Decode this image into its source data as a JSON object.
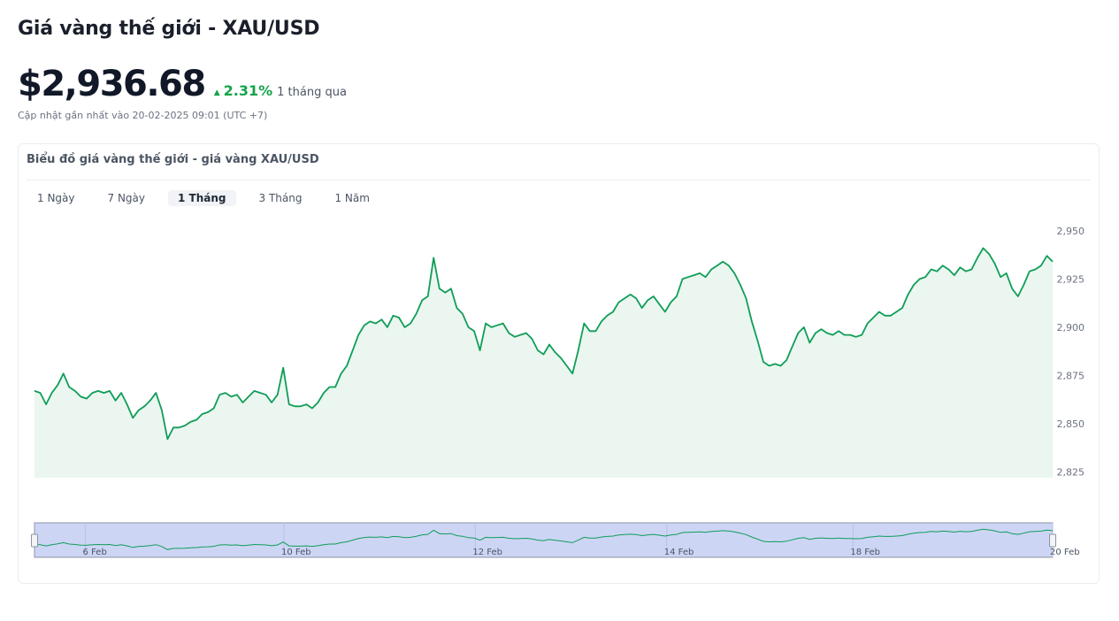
{
  "header": {
    "title": "Giá vàng thế giới - XAU/USD",
    "price": "$2,936.68",
    "change_percent": "2.31%",
    "change_period": "1 tháng qua",
    "updated": "Cập nhật gần nhất vào 20-02-2025 09:01 (UTC +7)"
  },
  "card": {
    "title": "Biểu đồ giá vàng thế giới - giá vàng XAU/USD",
    "tabs": [
      {
        "label": "1 Ngày",
        "active": false
      },
      {
        "label": "7 Ngày",
        "active": false
      },
      {
        "label": "1 Tháng",
        "active": true
      },
      {
        "label": "3 Tháng",
        "active": false
      },
      {
        "label": "1 Năm",
        "active": false
      }
    ]
  },
  "colors": {
    "line": "#0f9d58",
    "area": "#eaf6ef",
    "navigator_fill": "#cdd5f5",
    "navigator_border": "#8d93a6",
    "positive": "#16a34a"
  },
  "chart_data": {
    "type": "area",
    "y_ticks": [
      "2,825",
      "2,850",
      "2,875",
      "2,900",
      "2,925",
      "2,950"
    ],
    "y_tick_values": [
      2825,
      2850,
      2875,
      2900,
      2925,
      2950
    ],
    "ylim": [
      2822,
      2955
    ],
    "navigator_ticks": [
      "6 Feb",
      "10 Feb",
      "12 Feb",
      "14 Feb",
      "18 Feb",
      "20 Feb"
    ],
    "navigator_tick_positions": [
      0.05,
      0.245,
      0.433,
      0.621,
      0.804,
      1.0
    ],
    "grid": false,
    "series": [
      {
        "values": [
          2867,
          2866,
          2860,
          2866,
          2870,
          2876,
          2869,
          2867,
          2864,
          2863,
          2866,
          2867,
          2866,
          2867,
          2862,
          2866,
          2860,
          2853,
          2857,
          2859,
          2862,
          2866,
          2857,
          2842,
          2848,
          2848,
          2849,
          2851,
          2852,
          2855,
          2856,
          2858,
          2865,
          2866,
          2864,
          2865,
          2861,
          2864,
          2867,
          2866,
          2865,
          2861,
          2865,
          2879,
          2860,
          2859,
          2859,
          2860,
          2858,
          2861,
          2866,
          2869,
          2869,
          2876,
          2880,
          2888,
          2896,
          2901,
          2903,
          2902,
          2904,
          2900,
          2906,
          2905,
          2900,
          2902,
          2907,
          2914,
          2916,
          2936,
          2920,
          2918,
          2920,
          2910,
          2907,
          2900,
          2898,
          2888,
          2902,
          2900,
          2901,
          2902,
          2897,
          2895,
          2896,
          2897,
          2894,
          2888,
          2886,
          2891,
          2887,
          2884,
          2880,
          2876,
          2888,
          2902,
          2898,
          2898,
          2903,
          2906,
          2908,
          2913,
          2915,
          2917,
          2915,
          2910,
          2914,
          2916,
          2912,
          2908,
          2913,
          2916,
          2925,
          2926,
          2927,
          2928,
          2926,
          2930,
          2932,
          2934,
          2932,
          2928,
          2922,
          2915,
          2903,
          2893,
          2882,
          2880,
          2881,
          2880,
          2883,
          2890,
          2897,
          2900,
          2892,
          2897,
          2899,
          2897,
          2896,
          2898,
          2896,
          2896,
          2895,
          2896,
          2902,
          2905,
          2908,
          2906,
          2906,
          2908,
          2910,
          2917,
          2922,
          2925,
          2926,
          2930,
          2929,
          2932,
          2930,
          2927,
          2931,
          2929,
          2930,
          2936,
          2941,
          2938,
          2933,
          2926,
          2928,
          2920,
          2916,
          2922,
          2929,
          2930,
          2932,
          2937,
          2934
        ]
      }
    ]
  }
}
